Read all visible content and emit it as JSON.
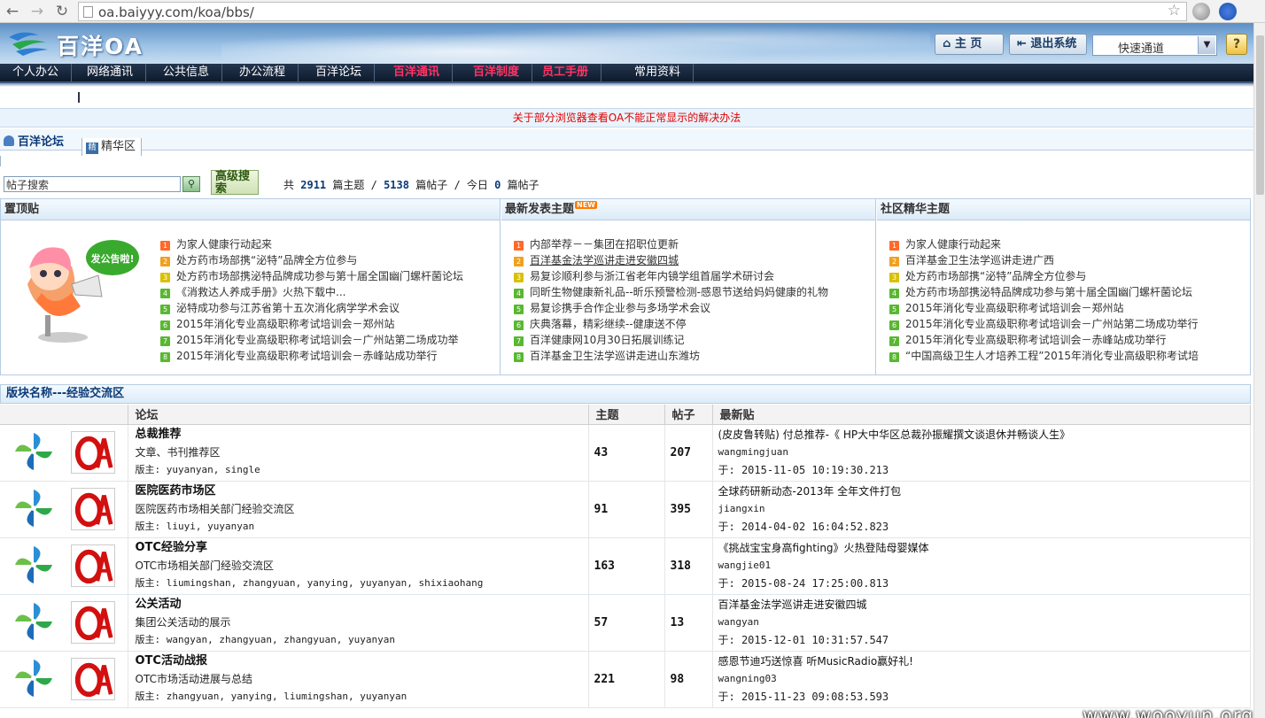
{
  "browser": {
    "url": "oa.baiyyy.com/koa/bbs/",
    "back": "←",
    "forward": "→",
    "reload": "↻"
  },
  "header": {
    "logo_text": "百洋OA",
    "home_label": "主 页",
    "logout_label": "退出系统",
    "quick_channel": "快速通道",
    "help_glyph": "?"
  },
  "menu": [
    {
      "label": "个人办公",
      "highlight": false
    },
    {
      "label": "网络通讯",
      "highlight": false
    },
    {
      "label": "公共信息",
      "highlight": false
    },
    {
      "label": "办公流程",
      "highlight": false
    },
    {
      "label": "百洋论坛",
      "highlight": false
    },
    {
      "label": "百洋通讯",
      "highlight": true
    },
    {
      "label": "百洋制度",
      "highlight": true
    },
    {
      "label": "员工手册",
      "highlight": true
    },
    {
      "label": "常用资料",
      "highlight": false
    }
  ],
  "notice": "关于部分浏览器查看OA不能正常显示的解决办法",
  "forum": {
    "title": "百洋论坛",
    "tab_badge": "精",
    "tab_label": "精华区"
  },
  "search": {
    "placeholder": "帖子搜索",
    "button_icon": "search-icon",
    "advanced_label": "高级搜索"
  },
  "stats": {
    "prefix": "共",
    "topics": "2911",
    "topics_unit": "篇主题 /",
    "posts": "5138",
    "posts_unit": "篇帖子 / 今日",
    "today": "0",
    "today_unit": "篇帖子"
  },
  "pinned": {
    "title": "置顶贴",
    "mascot_text": "发公告啦!",
    "items": [
      "为家人健康行动起来",
      "处方药市场部携“泌特”品牌全方位参与",
      "处方药市场部携泌特品牌成功参与第十届全国幽门螺杆菌论坛",
      "《消救达人养成手册》火热下载中...",
      "泌特成功参与江苏省第十五次消化病学学术会议",
      "2015年消化专业高级职称考试培训会－郑州站",
      "2015年消化专业高级职称考试培训会－广州站第二场成功举",
      "2015年消化专业高级职称考试培训会－赤峰站成功举行"
    ]
  },
  "latest_topics": {
    "title": "最新发表主题",
    "new_badge": "NEW",
    "items": [
      "内部举荐－－集团在招职位更新",
      "百洋基金法学巡讲走进安徽四城",
      "易复诊顺利参与浙江省老年内镜学组首届学术研讨会",
      "同昕生物健康新礼品--昕乐预警检测-感恩节送给妈妈健康的礼物",
      "易复诊携手合作企业参与多场学术会议",
      "庆典落幕，精彩继续--健康送不停",
      "百洋健康网10月30日拓展训练记",
      "百洋基金卫生法学巡讲走进山东潍坊"
    ]
  },
  "featured": {
    "title": "社区精华主题",
    "items": [
      "为家人健康行动起来",
      "百洋基金卫生法学巡讲走进广西",
      "处方药市场部携“泌特”品牌全方位参与",
      "处方药市场部携泌特品牌成功参与第十届全国幽门螺杆菌论坛",
      "2015年消化专业高级职称考试培训会－郑州站",
      "2015年消化专业高级职称考试培训会－广州站第二场成功举行",
      "2015年消化专业高级职称考试培训会－赤峰站成功举行",
      "“中国高级卫生人才培养工程”2015年消化专业高级职称考试培"
    ]
  },
  "block": {
    "title": "版块名称---经验交流区",
    "col_forum": "论坛",
    "col_topics": "主题",
    "col_posts": "帖子",
    "col_latest": "最新贴",
    "rows": [
      {
        "name": "总裁推荐",
        "desc": "文章、书刊推荐区",
        "mods": "版主: yuyanyan, single",
        "topics": "43",
        "posts": "207",
        "latest_title": "(皮皮鲁转贴) 付总推荐-《 HP大中华区总裁孙振耀撰文谈退休并畅谈人生》",
        "latest_user": "wangmingjuan",
        "latest_time": "于: 2015-11-05 10:19:30.213"
      },
      {
        "name": "医院医药市场区",
        "desc": "医院医药市场相关部门经验交流区",
        "mods": "版主: liuyi, yuyanyan",
        "topics": "91",
        "posts": "395",
        "latest_title": "全球药研新动态-2013年 全年文件打包",
        "latest_user": "jiangxin",
        "latest_time": "于: 2014-04-02 16:04:52.823"
      },
      {
        "name": "OTC经验分享",
        "desc": "OTC市场相关部门经验交流区",
        "mods": "版主: liumingshan, zhangyuan, yanying, yuyanyan, shixiaohang",
        "topics": "163",
        "posts": "318",
        "latest_title": "《挑战宝宝身高fighting》火热登陆母婴媒体",
        "latest_user": "wangjie01",
        "latest_time": "于: 2015-08-24 17:25:00.813"
      },
      {
        "name": "公关活动",
        "desc": "集团公关活动的展示",
        "mods": "版主: wangyan, zhangyuan, zhangyuan, yuyanyan",
        "topics": "57",
        "posts": "13",
        "latest_title": "百洋基金法学巡讲走进安徽四城",
        "latest_user": "wangyan",
        "latest_time": "于: 2015-12-01 10:31:57.547"
      },
      {
        "name": "OTC活动战报",
        "desc": "OTC市场活动进展与总结",
        "mods": "版主: zhangyuan, yanying, liumingshan, yuyanyan",
        "topics": "221",
        "posts": "98",
        "latest_title": "感恩节迪巧送惊喜 听MusicRadio赢好礼!",
        "latest_user": "wangning03",
        "latest_time": "于: 2015-11-23 09:08:53.593"
      }
    ]
  },
  "watermark": "www.wooyun.org"
}
